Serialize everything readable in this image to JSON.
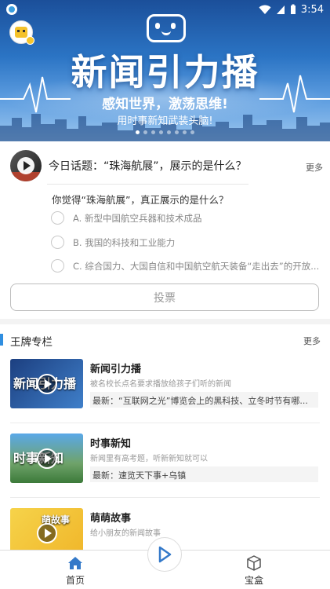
{
  "status_bar": {
    "time": "3:54"
  },
  "banner": {
    "title": "新闻引力播",
    "subtitle": "感知世界，激荡思维!",
    "tagline": "用时事新知武装头脑!",
    "pages": 8,
    "active_page": 1
  },
  "topic": {
    "title": "今日话题：“珠海航展”，展示的是什么？",
    "more": "更多",
    "question": "你觉得“珠海航展”，真正展示的是什么？",
    "options": [
      "A. 新型中国航空兵器和技术成品",
      "B. 我国的科技和工业能力",
      "C. 综合国力、大国自信和中国航空航天装备“走出去”的开放..."
    ],
    "vote": "投票"
  },
  "columns": {
    "header": "王牌专栏",
    "more": "更多",
    "items": [
      {
        "name": "新闻引力播",
        "desc": "被名校长点名要求播放给孩子们听的新闻",
        "latest": "最新：“互联网之光”博览会上的黑科技、立冬时节有哪...",
        "thumb_label": "新闻引力播",
        "thumb_bg": "#1f4f9a"
      },
      {
        "name": "时事新知",
        "desc": "新闻里有高考题，听新新知就可以",
        "latest": "最新：速览天下事+乌镇",
        "thumb_label": "时事新知",
        "thumb_bg": "#3d8fd1"
      },
      {
        "name": "萌萌故事",
        "desc": "给小朋友的新闻故事",
        "latest": "",
        "thumb_label": "萌故事",
        "thumb_bg": "#f2c52f"
      }
    ]
  },
  "bottom_nav": {
    "home": "首页",
    "treasure": "宝盒"
  },
  "colors": {
    "accent": "#2f8ee0",
    "nav_blue": "#3479c9"
  }
}
